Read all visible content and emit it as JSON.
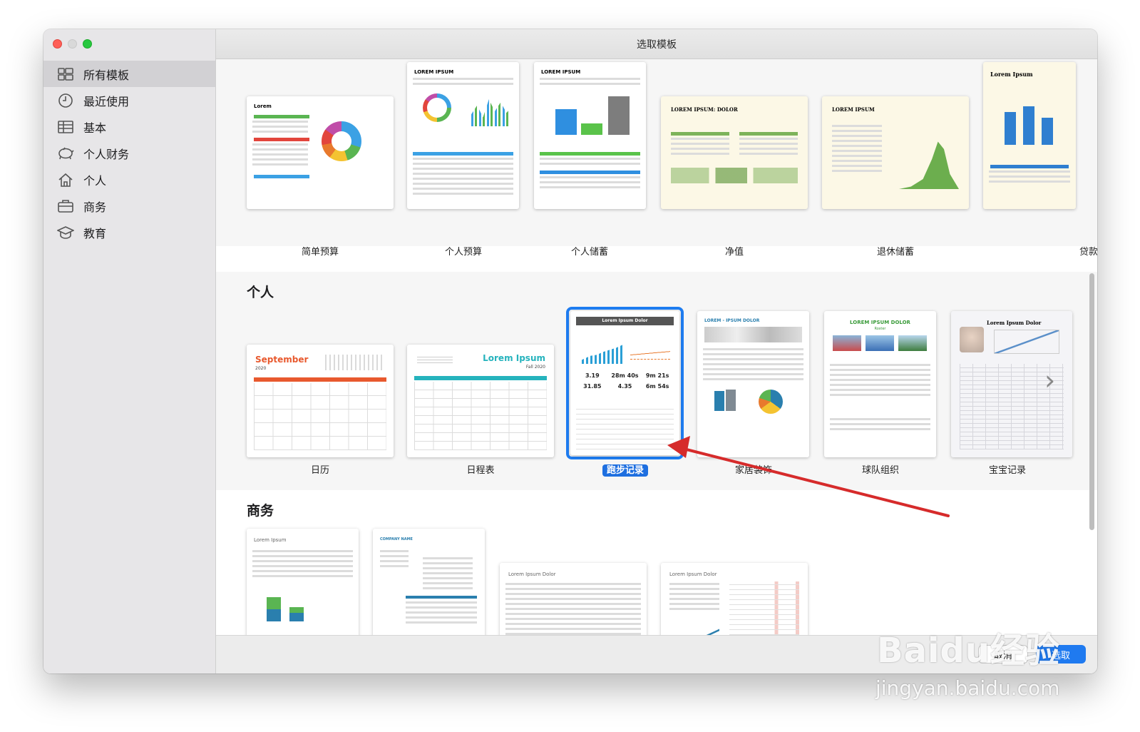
{
  "window": {
    "title": "选取模板"
  },
  "sidebar": {
    "items": [
      {
        "label": "所有模板",
        "icon": "grid-icon",
        "active": true
      },
      {
        "label": "最近使用",
        "icon": "clock-icon",
        "active": false
      },
      {
        "label": "基本",
        "icon": "table-icon",
        "active": false
      },
      {
        "label": "个人财务",
        "icon": "piggy-bank-icon",
        "active": false
      },
      {
        "label": "个人",
        "icon": "house-icon",
        "active": false
      },
      {
        "label": "商务",
        "icon": "briefcase-icon",
        "active": false
      },
      {
        "label": "教育",
        "icon": "graduation-cap-icon",
        "active": false
      }
    ]
  },
  "finance_row": {
    "templates": [
      {
        "label": "简单预算",
        "thumb_title": "Lorem"
      },
      {
        "label": "个人预算",
        "thumb_title": "LOREM IPSUM"
      },
      {
        "label": "个人储蓄",
        "thumb_title": "LOREM IPSUM"
      },
      {
        "label": "净值",
        "thumb_title": "LOREM IPSUM: DOLOR"
      },
      {
        "label": "退休储蓄",
        "thumb_title": "LOREM IPSUM"
      },
      {
        "label": "贷款比较",
        "thumb_title": "Lorem Ipsum"
      }
    ]
  },
  "personal": {
    "heading": "个人",
    "templates": [
      {
        "label": "日历",
        "thumb_title": "September",
        "thumb_sub": "2020"
      },
      {
        "label": "日程表",
        "thumb_title": "Lorem Ipsum",
        "thumb_sub": "Fall 2020"
      },
      {
        "label": "跑步记录",
        "thumb_title": "Lorem Ipsum Dolor",
        "stats": [
          "3.19",
          "28m 40s",
          "9m 21s",
          "31.85",
          "4.35",
          "6m 54s"
        ],
        "selected": true
      },
      {
        "label": "家居装饰",
        "thumb_title": "LOREM - IPSUM DOLOR"
      },
      {
        "label": "球队组织",
        "thumb_title": "LOREM IPSUM DOLOR",
        "thumb_sub": "Roster"
      },
      {
        "label": "宝宝记录",
        "thumb_title": "Lorem Ipsum Dolor"
      }
    ]
  },
  "business": {
    "heading": "商务",
    "templates": [
      {
        "thumb_title": "Lorem Ipsum"
      },
      {
        "thumb_title": "COMPANY NAME"
      },
      {
        "thumb_title": "Lorem Ipsum Dolor"
      },
      {
        "thumb_title": "Lorem Ipsum Dolor"
      }
    ]
  },
  "footer": {
    "cancel": "取消",
    "choose": "选取"
  },
  "watermark": {
    "logo": "Baidu经验",
    "url": "jingyan.baidu.com"
  },
  "colors": {
    "accent": "#1e7cf0",
    "annotation_arrow": "#d62b2b"
  }
}
